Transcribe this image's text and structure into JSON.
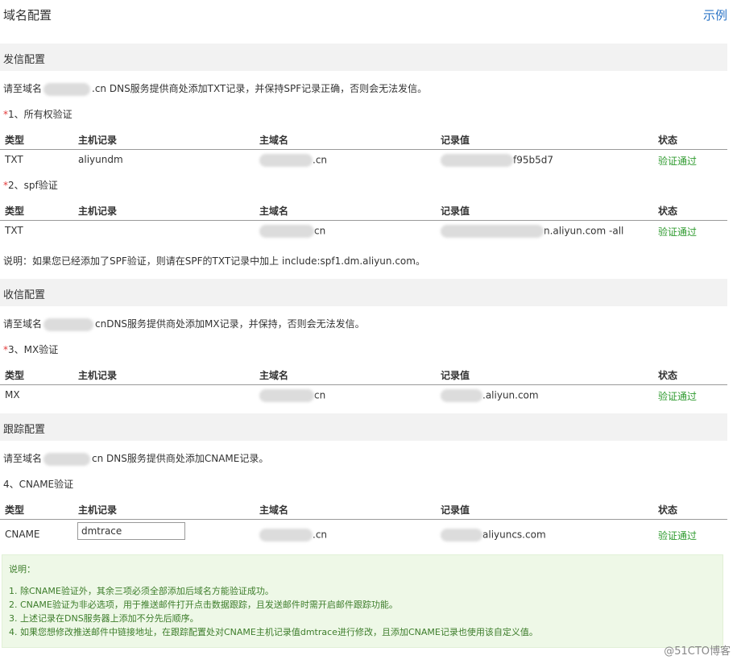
{
  "page": {
    "title": "域名配置",
    "example_link": "示例"
  },
  "table_headers": {
    "type": "类型",
    "host": "主机记录",
    "domain": "主域名",
    "value": "记录值",
    "status": "状态"
  },
  "sending": {
    "title": "发信配置",
    "intro_prefix": "请至域名",
    "intro_suffix": ".cn DNS服务提供商处添加TXT记录，并保持SPF记录正确，否则会无法发信。",
    "ownership": {
      "label": "1、所有权验证",
      "row": {
        "type": "TXT",
        "host": "aliyundm",
        "domain": ".cn",
        "value": "f95b5d7",
        "status": "验证通过"
      }
    },
    "spf": {
      "label": "2、spf验证",
      "row": {
        "type": "TXT",
        "host": "",
        "domain": "cn",
        "value": "n.aliyun.com -all",
        "status": "验证通过"
      }
    },
    "note": "说明：如果您已经添加了SPF验证，则请在SPF的TXT记录中加上 include:spf1.dm.aliyun.com。"
  },
  "receiving": {
    "title": "收信配置",
    "intro_prefix": "请至域名",
    "intro_suffix": "cnDNS服务提供商处添加MX记录，并保持，否则会无法发信。",
    "mx": {
      "label": "3、MX验证",
      "row": {
        "type": "MX",
        "host": "",
        "domain": "cn",
        "value": ".aliyun.com",
        "status": "验证通过"
      }
    }
  },
  "tracking": {
    "title": "跟踪配置",
    "intro_prefix": "请至域名",
    "intro_suffix": "cn DNS服务提供商处添加CNAME记录。",
    "cname": {
      "label": "4、CNAME验证",
      "row": {
        "type": "CNAME",
        "host_value": "dmtrace",
        "domain": ".cn",
        "value": "aliyuncs.com",
        "status": "验证通过"
      }
    }
  },
  "notes": {
    "title": "说明：",
    "items": [
      "1. 除CNAME验证外，其余三项必须全部添加后域名方能验证成功。",
      "2. CNAME验证为非必选项，用于推送邮件打开点击数据跟踪，且发送邮件时需开启邮件跟踪功能。",
      "3. 上述记录在DNS服务器上添加不分先后顺序。",
      "4. 如果您想修改推送邮件中链接地址，在跟踪配置处对CNAME主机记录值dmtrace进行修改，且添加CNAME记录也使用该自定义值。"
    ]
  },
  "watermark": "@51CTO博客",
  "colors": {
    "link": "#2b74c6",
    "success": "#2e9a2e",
    "required": "#e23a3a",
    "note_bg": "#eef8e7"
  }
}
